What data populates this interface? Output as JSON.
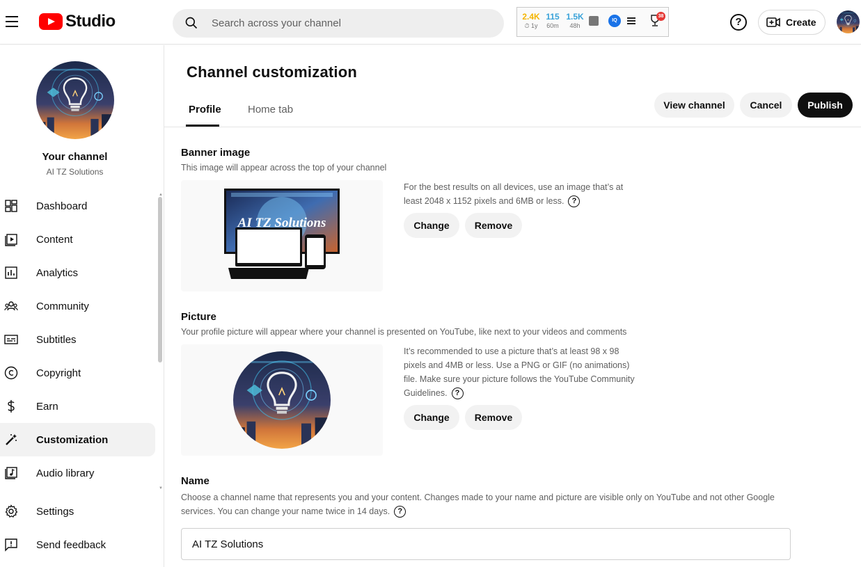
{
  "header": {
    "logo_text": "Studio",
    "search_placeholder": "Search across your channel",
    "create_label": "Create",
    "help_glyph": "?"
  },
  "extension": {
    "stats": [
      {
        "value": "2.4K",
        "sub": "⏱ 1y",
        "color": "#f4b400"
      },
      {
        "value": "115",
        "sub": "60m",
        "color": "#3ba3d9"
      },
      {
        "value": "1.5K",
        "sub": "48h",
        "color": "#3ba3d9"
      }
    ],
    "iq_label": "IQ",
    "badge_count": "38"
  },
  "sidebar": {
    "channel_label": "Your channel",
    "channel_name": "AI TZ Solutions",
    "items": [
      {
        "label": "Dashboard",
        "icon": "dashboard-icon"
      },
      {
        "label": "Content",
        "icon": "content-icon"
      },
      {
        "label": "Analytics",
        "icon": "analytics-icon"
      },
      {
        "label": "Community",
        "icon": "community-icon"
      },
      {
        "label": "Subtitles",
        "icon": "subtitles-icon"
      },
      {
        "label": "Copyright",
        "icon": "copyright-icon"
      },
      {
        "label": "Earn",
        "icon": "earn-icon"
      },
      {
        "label": "Customization",
        "icon": "customization-icon",
        "active": true
      },
      {
        "label": "Audio library",
        "icon": "audio-library-icon"
      }
    ],
    "settings_label": "Settings",
    "feedback_label": "Send feedback"
  },
  "main": {
    "title": "Channel customization",
    "tabs": [
      {
        "label": "Profile",
        "active": true
      },
      {
        "label": "Home tab"
      }
    ],
    "actions": {
      "view_channel": "View channel",
      "cancel": "Cancel",
      "publish": "Publish"
    },
    "banner": {
      "title": "Banner image",
      "description": "This image will appear across the top of your channel",
      "info": "For the best results on all devices, use an image that’s at least 2048 x 1152 pixels and 6MB or less.",
      "change": "Change",
      "remove": "Remove",
      "watermark": "AI TZ Solutions"
    },
    "picture": {
      "title": "Picture",
      "description": "Your profile picture will appear where your channel is presented on YouTube, like next to your videos and comments",
      "info": "It’s recommended to use a picture that’s at least 98 x 98 pixels and 4MB or less. Use a PNG or GIF (no animations) file. Make sure your picture follows the YouTube Community Guidelines.",
      "change": "Change",
      "remove": "Remove"
    },
    "name": {
      "title": "Name",
      "description": "Choose a channel name that represents you and your content. Changes made to your name and picture are visible only on YouTube and not other Google services. You can change your name twice in 14 days.",
      "value": "AI TZ Solutions"
    }
  },
  "colors": {
    "brand_red": "#ff0000",
    "publish_bg": "#0f0f0f",
    "active_nav_bg": "#f2f2f2"
  }
}
